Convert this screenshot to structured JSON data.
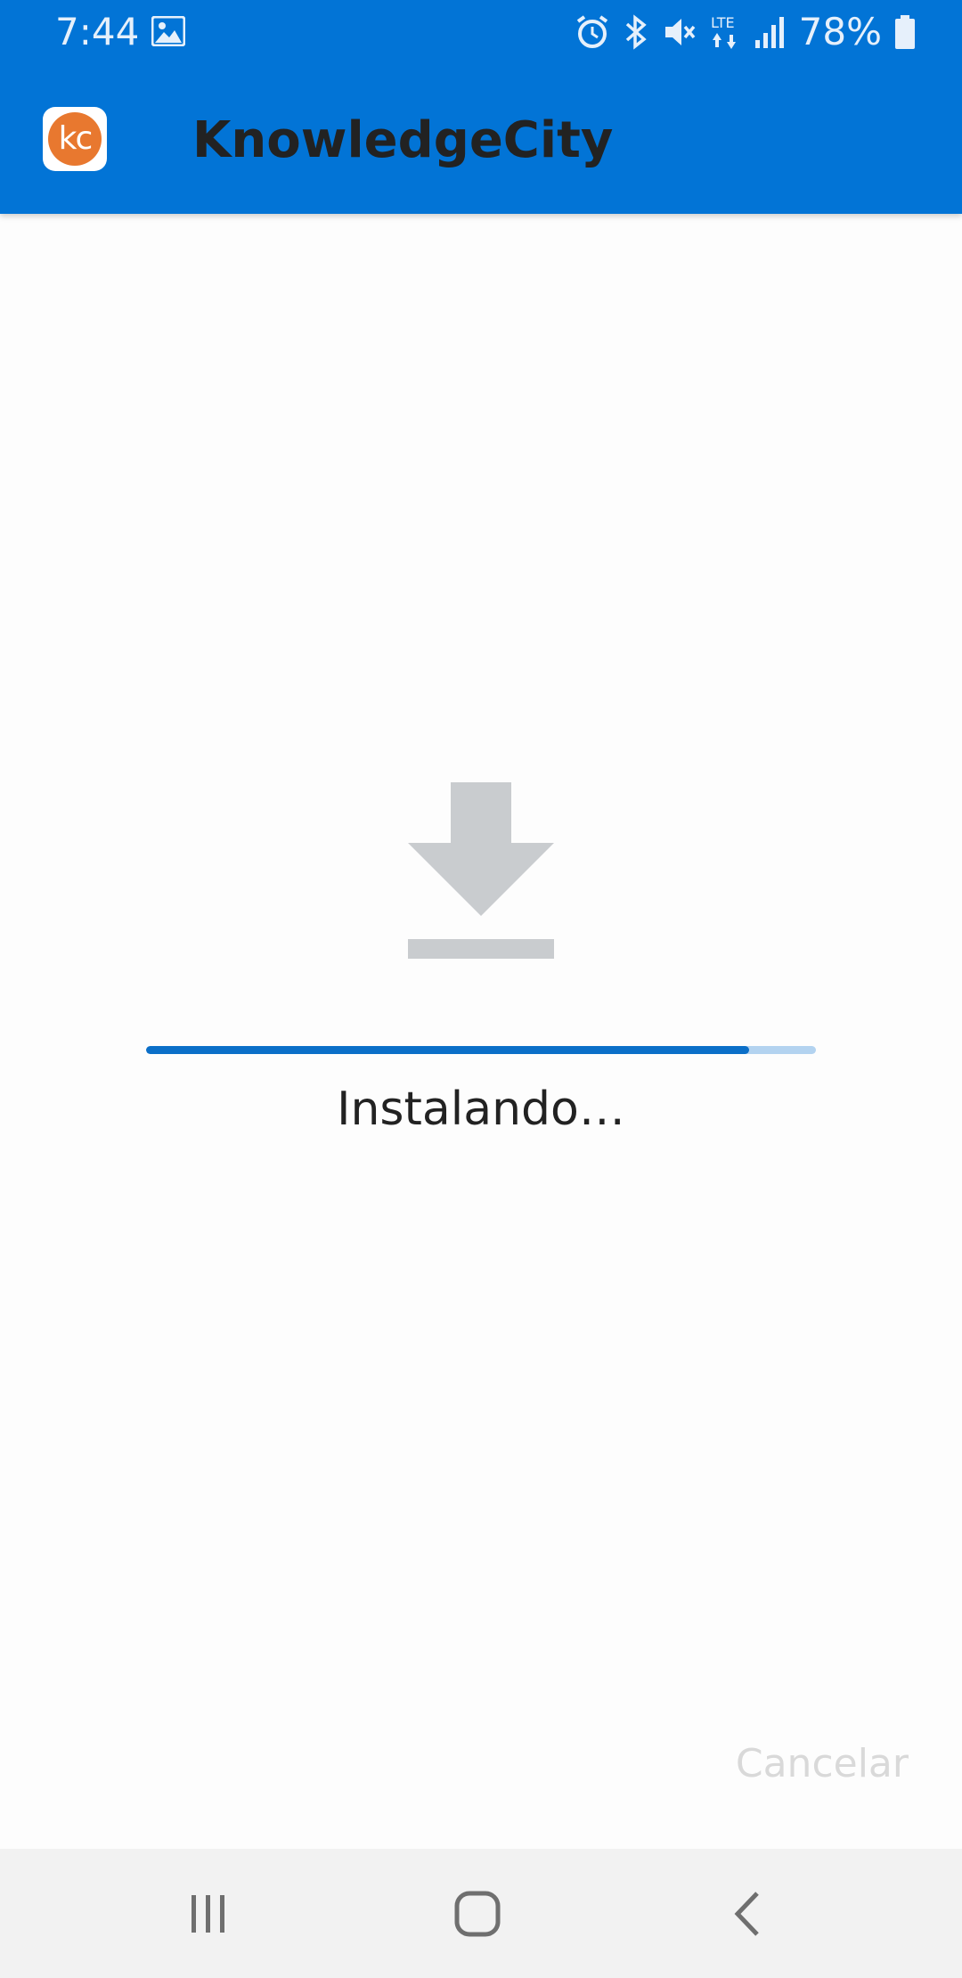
{
  "status_bar": {
    "time": "7:44",
    "battery": "78%",
    "icons": [
      "gallery-icon",
      "alarm-icon",
      "bluetooth-icon",
      "mute-icon",
      "lte-icon",
      "signal-icon",
      "battery-icon"
    ]
  },
  "app_bar": {
    "title": "KnowledgeCity",
    "logo_text": "kc"
  },
  "installer": {
    "status": "Instalando…",
    "progress": 0.9,
    "cancel_label": "Cancelar"
  },
  "navigation": {
    "buttons": [
      "recents-icon",
      "home-icon",
      "back-icon"
    ]
  },
  "colors": {
    "header": "#0274d6",
    "logo": "#e8782f",
    "progress_fill": "#0b6fc8",
    "progress_track": "#b3d3f0",
    "icon_gray": "#c9cccf"
  }
}
